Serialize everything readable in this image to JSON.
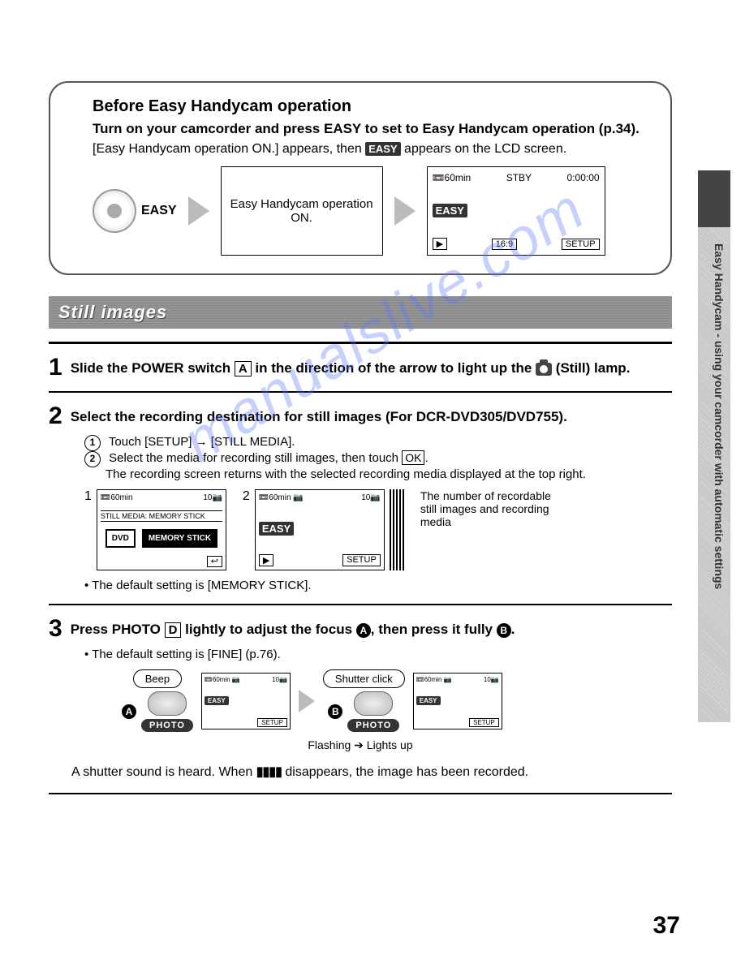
{
  "side_tab": "Easy Handycam - using your camcorder with automatic settings",
  "watermark": "manualslive.com",
  "intro": {
    "heading": "Before Easy Handycam operation",
    "lead": "Turn on your camcorder and press EASY to set to Easy Handycam operation (p.34).",
    "body_pre": "[Easy Handycam operation ON.] appears, then ",
    "badge": "EASY",
    "body_post": " appears on the LCD screen.",
    "easy_btn": "EASY",
    "lcd1": "Easy Handycam operation ON.",
    "lcd2": {
      "top_left": "📼60min",
      "top_mid": "STBY",
      "top_right": "0:00:00",
      "badge": "EASY",
      "bot_left": "▶",
      "bot_mid": "16:9",
      "bot_right": "SETUP"
    }
  },
  "section_title": "Still images",
  "steps": [
    {
      "num": "1",
      "text_a": "Slide the POWER switch ",
      "box": "A",
      "text_b": " in the direction of the arrow to light up the ",
      "text_c": " (Still) lamp."
    },
    {
      "num": "2",
      "text": "Select the recording destination for still images (For DCR-DVD305/DVD755).",
      "subs": [
        {
          "n": "1",
          "t1": "Touch [SETUP]",
          "t2": "[STILL MEDIA]."
        },
        {
          "n": "2",
          "t1": "Select the media for recording still images, then touch ",
          "ok": "OK",
          "t2": "The recording screen returns with the selected recording media displayed at the top right."
        }
      ],
      "screens": [
        {
          "n": "1",
          "top_l": "📼60min",
          "top_r": "10📷",
          "bar": "STILL MEDIA: MEMORY STICK",
          "opt1": "DVD",
          "opt2": "MEMORY STICK"
        },
        {
          "n": "2",
          "top_l": "📼60min 📷",
          "top_r": "10📷",
          "badge": "EASY",
          "setup": "SETUP"
        }
      ],
      "annotation": "The number of recordable still images and recording media",
      "note": "The default setting is [MEMORY STICK]."
    },
    {
      "num": "3",
      "t1": "Press PHOTO ",
      "box": "D",
      "t2": " lightly to adjust the focus ",
      "ca": "A",
      "t3": ", then press it fully ",
      "cb": "B",
      "note": "The default setting is [FINE] (p.76).",
      "beep": "Beep",
      "shutter": "Shutter click",
      "photo": "PHOTO",
      "lcd": {
        "top_l": "📼60min 📷",
        "top_r": "10📷",
        "badge": "EASY",
        "setup": "SETUP"
      },
      "flash_a": "Flashing",
      "flash_b": "Lights up",
      "trail_a": "A shutter sound is heard. When ",
      "trail_b": " disappears, the image has been recorded."
    }
  ],
  "page_number": "37"
}
